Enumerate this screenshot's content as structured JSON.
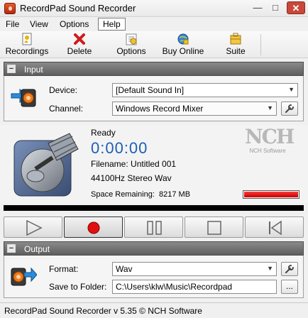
{
  "window": {
    "title": "RecordPad Sound Recorder"
  },
  "menu": [
    "File",
    "View",
    "Options",
    "Help"
  ],
  "toolbar": {
    "recordings": "Recordings",
    "delete": "Delete",
    "options": "Options",
    "buy_online": "Buy Online",
    "suite": "Suite"
  },
  "input": {
    "title": "Input",
    "device_label": "Device:",
    "device_value": "[Default Sound In]",
    "channel_label": "Channel:",
    "channel_value": "Windows Record Mixer"
  },
  "status": {
    "state": "Ready",
    "time": "0:00:00",
    "filename": "Filename: Untitled 001",
    "format": "44100Hz Stereo Wav",
    "space_label": "Space Remaining:",
    "space_value": "8217 MB",
    "space_fraction": 1.0,
    "logo_text": "NCH",
    "logo_sub": "NCH Software"
  },
  "output": {
    "title": "Output",
    "format_label": "Format:",
    "format_value": "Wav",
    "folder_label": "Save to Folder:",
    "folder_value": "C:\\Users\\klw\\Music\\Recordpad",
    "browse_label": "..."
  },
  "statusbar": {
    "text": "RecordPad Sound Recorder v 5.35 © NCH Software"
  },
  "icons": {
    "toolbar": [
      "recordings-icon",
      "delete-icon",
      "options-icon",
      "buy-online-icon",
      "suite-icon"
    ],
    "transport": [
      "play-icon",
      "record-icon",
      "pause-icon",
      "stop-icon",
      "skip-to-start-icon"
    ]
  },
  "colors": {
    "time": "#1d5fb3",
    "record": "#e01010",
    "space_bar": "#e00000"
  }
}
